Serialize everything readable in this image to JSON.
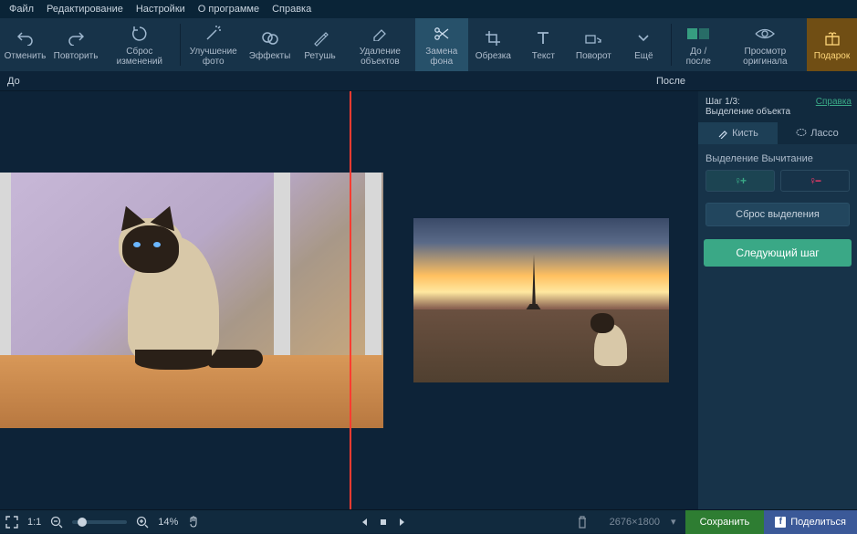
{
  "menu": {
    "file": "Файл",
    "edit": "Редактирование",
    "settings": "Настройки",
    "about": "О программе",
    "help": "Справка"
  },
  "tools": {
    "undo": "Отменить",
    "redo": "Повторить",
    "reset": "Сброс изменений",
    "enhance": "Улучшение фото",
    "effects": "Эффекты",
    "retouch": "Ретушь",
    "removeObjects": "Удаление объектов",
    "replaceBg": "Замена фона",
    "crop": "Обрезка",
    "text": "Текст",
    "rotate": "Поворот",
    "more": "Ещё",
    "beforeAfter": "До / после",
    "viewOriginal": "Просмотр оригинала",
    "gift": "Подарок"
  },
  "compare": {
    "before": "До",
    "after": "После"
  },
  "sidebar": {
    "stepLine1": "Шаг 1/3:",
    "stepLine2": "Выделение объекта",
    "helpLink": "Справка",
    "tabBrush": "Кисть",
    "tabLasso": "Лассо",
    "modeLabel": "Выделение   Вычитание",
    "add": "+",
    "sub": "−",
    "resetSel": "Сброс выделения",
    "nextStep": "Следующий шаг"
  },
  "status": {
    "fit": "1:1",
    "zoom": "14%",
    "dimensions": "2676×1800",
    "save": "Сохранить",
    "share": "Поделиться"
  }
}
